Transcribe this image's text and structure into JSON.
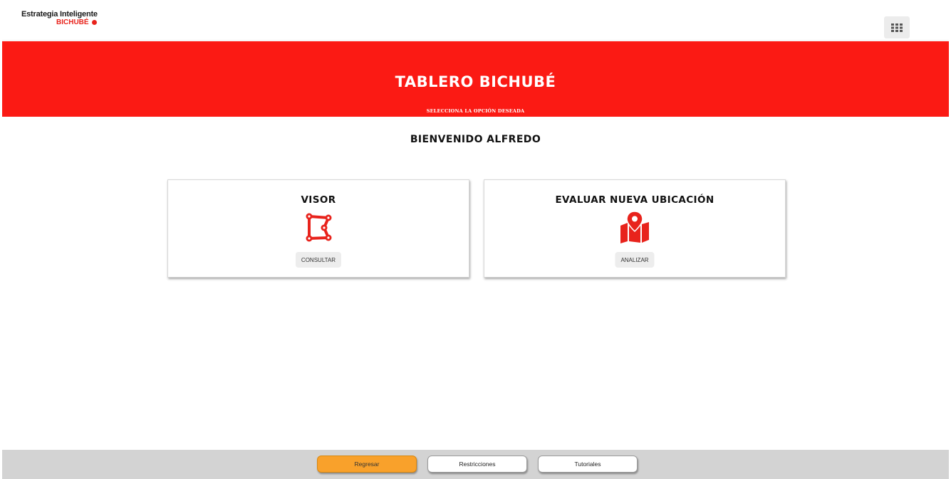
{
  "header": {
    "logo_line1": "Estrategia Inteligente",
    "logo_line2": "BICHUBÉ",
    "apps_icon": "grid-icon"
  },
  "banner": {
    "title": "TABLERO BICHUBÉ",
    "subtitle": "SELECCIONA LA OPCIÓN DESEADA",
    "color": "#fb1a14"
  },
  "welcome": "BIENVENIDO ALFREDO",
  "cards": [
    {
      "title": "VISOR",
      "icon": "polygon-map-icon",
      "button_label": "CONSULTAR"
    },
    {
      "title": "EVALUAR NUEVA UBICACIÓN",
      "icon": "map-location-icon",
      "button_label": "ANALIZAR"
    }
  ],
  "footer": {
    "buttons": [
      {
        "label": "Regresar",
        "color": "#f9a12b"
      },
      {
        "label": "Restricciones",
        "color": "#ffffff"
      },
      {
        "label": "Tutoriales",
        "color": "#ffffff"
      }
    ]
  }
}
